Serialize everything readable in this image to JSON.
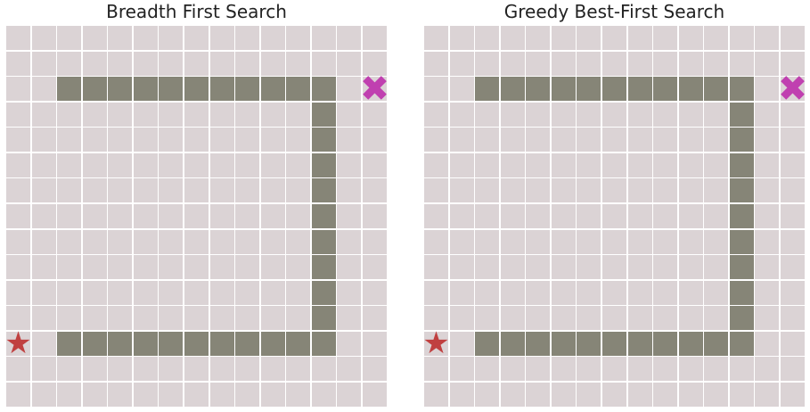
{
  "panels": [
    {
      "title": "Breadth First Search"
    },
    {
      "title": "Greedy Best-First Search"
    }
  ],
  "grid": {
    "rows": 15,
    "cols": 15,
    "walls": {
      "top_row": 2,
      "bottom_row": 12,
      "left_col": 2,
      "right_col": 12
    },
    "start": {
      "row": 12,
      "col": 0,
      "icon": "star-icon"
    },
    "goal": {
      "row": 2,
      "col": 14,
      "icon": "x-icon"
    }
  },
  "symbols": {
    "star": "★",
    "x": "✖"
  },
  "colors": {
    "cell": "#dbd3d5",
    "wall": "#868577",
    "start": "#c04040",
    "goal": "#c040b0"
  }
}
